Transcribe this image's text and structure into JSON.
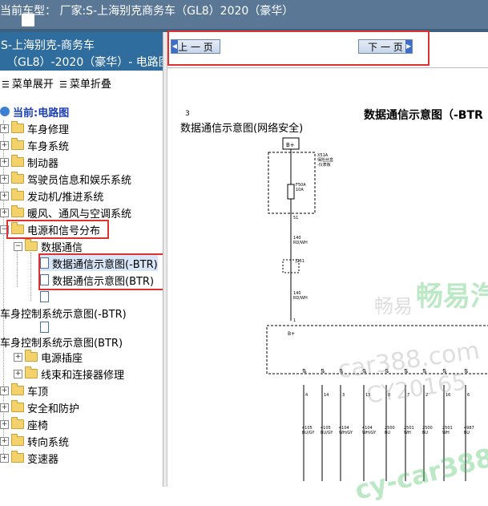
{
  "window": {
    "title": "当前车型： 厂家:S-上海别克商务车（GL8）2020（豪华）"
  },
  "left_panel": {
    "header_line1": "S-上海别克-商务车",
    "header_line2": "（GL8）-2020（豪华）- 电路图.",
    "expand_all": "菜单展开",
    "collapse_all": "菜单折叠",
    "tree": {
      "root_label": "当前:电路图",
      "items": [
        {
          "label": "车身修理"
        },
        {
          "label": "车身系统"
        },
        {
          "label": "制动器"
        },
        {
          "label": "驾驶员信息和娱乐系统"
        },
        {
          "label": "发动机/推进系统"
        },
        {
          "label": "暖风、通风与空调系统"
        },
        {
          "label": "电源和信号分布"
        },
        {
          "label": "数据通信"
        },
        {
          "label": "数据通信示意图(-BTR)"
        },
        {
          "label": "数据通信示意图(BTR)"
        },
        {
          "label": "车身控制系统示意图(-BTR)"
        },
        {
          "label": "车身控制系统示意图(BTR)"
        },
        {
          "label": "电源插座"
        },
        {
          "label": "线束和连接器修理"
        },
        {
          "label": "车顶"
        },
        {
          "label": "安全和防护"
        },
        {
          "label": "座椅"
        },
        {
          "label": "转向系统"
        },
        {
          "label": "变速器"
        }
      ]
    }
  },
  "navigation": {
    "prev_label": "上 一 页",
    "next_label": "下 一 页"
  },
  "diagram": {
    "page_marker": "3",
    "title": "数据通信示意图（-BTR",
    "subtitle": "数据通信示意图(网络安全)",
    "top_connector": "B+",
    "fuse_block_label": "X51A\n保险丝盒\n-仪表板",
    "fuse_label": "F50A\n10A",
    "pin_51": "51",
    "wire_1": "140\nRD/WH",
    "splice": "J251",
    "wire_2": "140\nRD/WH",
    "pin_b": "B+",
    "pin_1": "1",
    "bottom_pins": [
      "4",
      "14",
      "3",
      "13",
      "8",
      "7",
      "2",
      "16",
      "6"
    ],
    "bottom_wires": [
      "4105\nBU/GY",
      "4105\nBU/GY",
      "4104\nWH/GY",
      "4104\nWH/GY",
      "2500\nBU",
      "2501\nWH",
      "2500\nBU",
      "2501\nWH",
      "4987\nBU"
    ]
  },
  "watermarks": {
    "w1": "畅易",
    "w2": "畅易汽",
    "w3": "car388.com",
    "w4": "CY20165",
    "w5": "cy-car388"
  },
  "colors": {
    "topbar": "#5a7896",
    "panel_header": "#2f6d9e",
    "highlight": "#e03030"
  }
}
